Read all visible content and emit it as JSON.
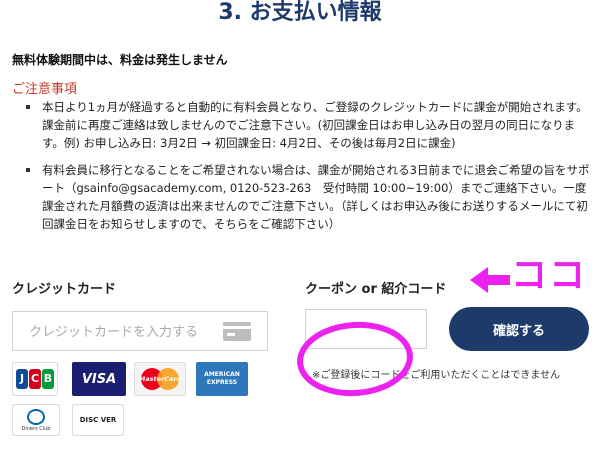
{
  "page": {
    "title": "3. お支払い情報"
  },
  "free_trial_notice": "無料体験期間中は、料金は発生しません",
  "caution": {
    "heading": "ご注意事項",
    "items": [
      "本日より1ヵ月が経過すると自動的に有料会員となり、ご登録のクレジットカードに課金が開始されます。課金前に再度ご連絡は致しませんのでご注意下さい。(初回課金日はお申し込み日の翌月の同日になります。例) お申し込み日: 3月2日 → 初回課金日: 4月2日、その後は毎月2日に課金)",
      "有料会員に移行となることをご希望されない場合は、課金が開始される3日前までに退会ご希望の旨をサポート（gsainfo@gsacademy.com, 0120-523-263　受付時間 10:00~19:00）までご連絡下さい。一度課金された月額費の返済は出来ませんのでご注意下さい。（詳しくはお申込み後にお送りするメールにて初回課金日をお知らせしますので、そちらをご確認下さい）"
    ]
  },
  "credit_card": {
    "label": "クレジットカード",
    "placeholder": "クレジットカードを入力する",
    "icon": "credit-card-icon",
    "brands": {
      "jcb": [
        "J",
        "C",
        "B"
      ],
      "visa": "VISA",
      "mastercard": "MasterCard",
      "amex": [
        "AMERICAN",
        "EXPRESS"
      ],
      "diners": "Diners Club",
      "discover": "DISC VER"
    }
  },
  "coupon": {
    "label": "クーポン or 紹介コード",
    "value": "",
    "confirm_label": "確認する",
    "note": "※ご登録後にコードをご利用いただくことはできません"
  },
  "annotation": {
    "text": "ココ",
    "color": "#ee22ee"
  },
  "colors": {
    "title": "#1d3a6b",
    "caution": "#c0392b",
    "button": "#1d3a6b"
  }
}
